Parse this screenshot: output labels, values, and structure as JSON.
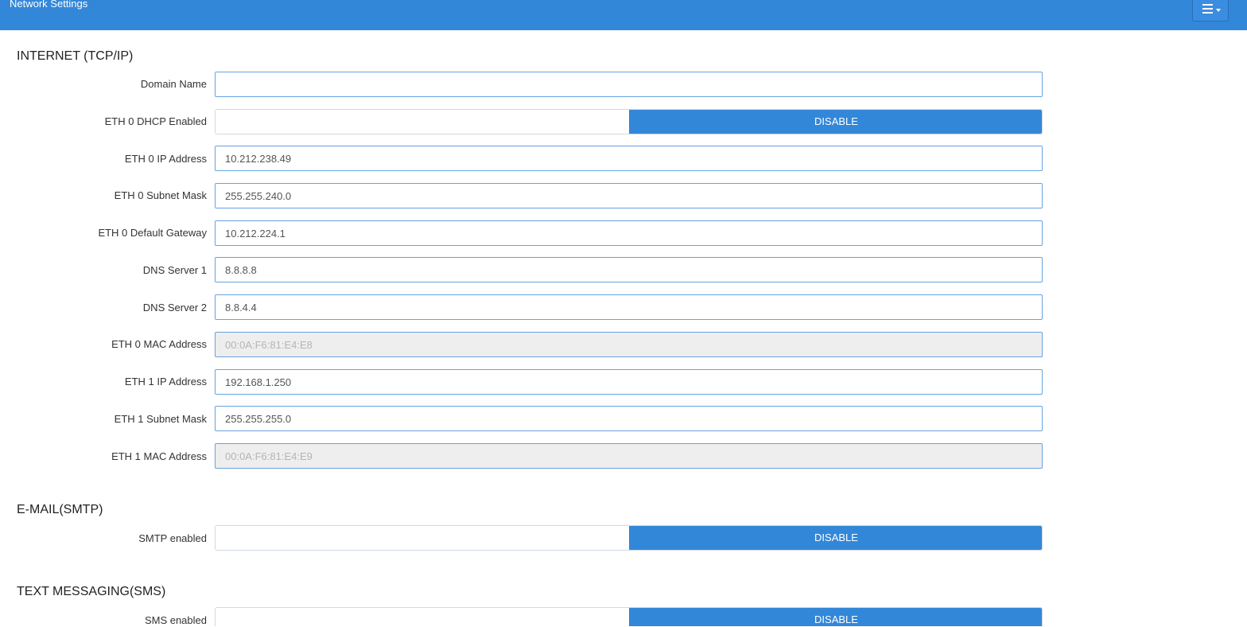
{
  "header": {
    "title": "Network Settings",
    "menu_icon": "hamburger-icon",
    "accent_color": "#3387d8"
  },
  "sections": {
    "internet": {
      "title": "INTERNET (TCP/IP)",
      "domain_name": {
        "label": "Domain Name",
        "value": ""
      },
      "eth0_dhcp": {
        "label": "ETH 0 DHCP Enabled",
        "state": "DISABLE"
      },
      "eth0_ip": {
        "label": "ETH 0 IP Address",
        "value": "10.212.238.49"
      },
      "eth0_subnet": {
        "label": "ETH 0 Subnet Mask",
        "value": "255.255.240.0"
      },
      "eth0_gateway": {
        "label": "ETH 0 Default Gateway",
        "value": "10.212.224.1"
      },
      "dns1": {
        "label": "DNS Server 1",
        "value": "8.8.8.8"
      },
      "dns2": {
        "label": "DNS Server 2",
        "value": "8.8.4.4"
      },
      "eth0_mac": {
        "label": "ETH 0 MAC Address",
        "value": "00:0A:F6:81:E4:E8"
      },
      "eth1_ip": {
        "label": "ETH 1 IP Address",
        "value": "192.168.1.250"
      },
      "eth1_subnet": {
        "label": "ETH 1 Subnet Mask",
        "value": "255.255.255.0"
      },
      "eth1_mac": {
        "label": "ETH 1 MAC Address",
        "value": "00:0A:F6:81:E4:E9"
      }
    },
    "email": {
      "title": "E-MAIL(SMTP)",
      "smtp_enabled": {
        "label": "SMTP enabled",
        "state": "DISABLE"
      }
    },
    "sms": {
      "title": "TEXT MESSAGING(SMS)",
      "sms_enabled": {
        "label": "SMS enabled",
        "state": "DISABLE"
      }
    }
  }
}
